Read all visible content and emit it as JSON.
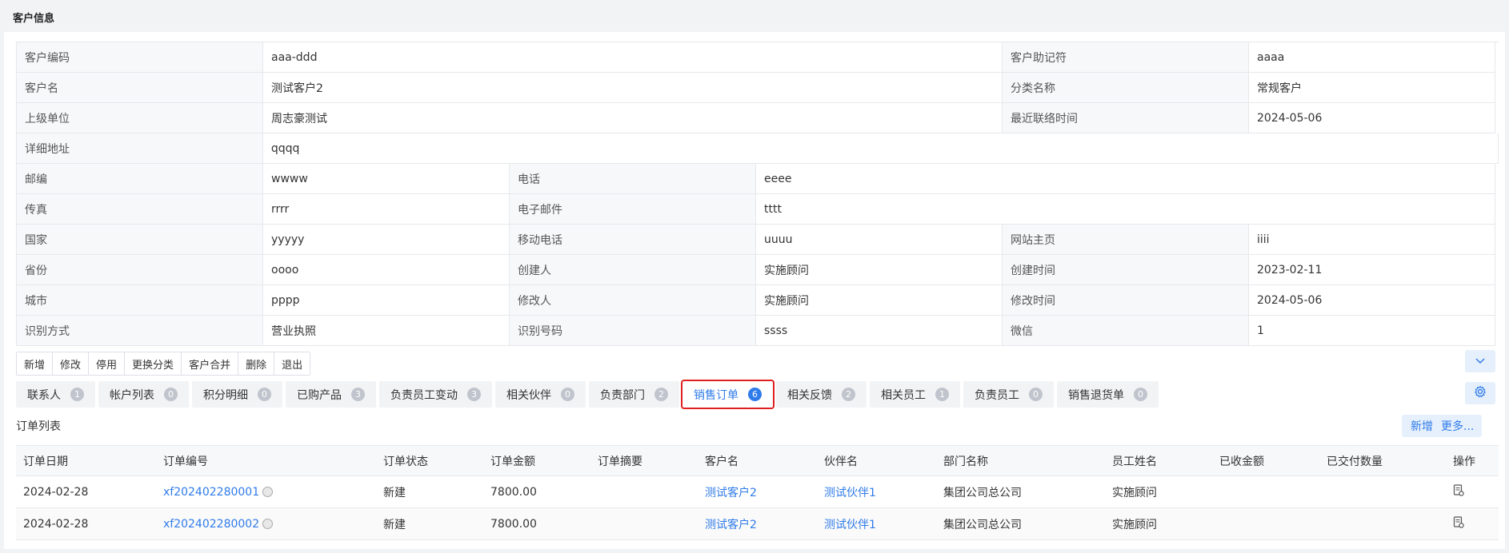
{
  "header": {
    "title": "客户信息"
  },
  "info": {
    "code_label": "客户编码",
    "code": "aaa-ddd",
    "mnemonic_label": "客户助记符",
    "mnemonic": "aaaa",
    "name_label": "客户名",
    "name": "测试客户2",
    "category_label": "分类名称",
    "category": "常规客户",
    "parent_label": "上级单位",
    "parent": "周志豪测试",
    "last_contact_label": "最近联络时间",
    "last_contact": "2024-05-06",
    "address_label": "详细地址",
    "address": "qqqq",
    "zip_label": "邮编",
    "zip": "wwww",
    "phone_label": "电话",
    "phone": "eeee",
    "fax_label": "传真",
    "fax": "rrrr",
    "email_label": "电子邮件",
    "email": "tttt",
    "country_label": "国家",
    "country": "yyyyy",
    "mobile_label": "移动电话",
    "mobile": "uuuu",
    "website_label": "网站主页",
    "website": "iiii",
    "province_label": "省份",
    "province": "oooo",
    "creator_label": "创建人",
    "creator": "实施顾问",
    "created_label": "创建时间",
    "created": "2023-02-11",
    "city_label": "城市",
    "city": "pppp",
    "modifier_label": "修改人",
    "modifier": "实施顾问",
    "modified_label": "修改时间",
    "modified": "2024-05-06",
    "id_method_label": "识别方式",
    "id_method": "营业执照",
    "id_number_label": "识别号码",
    "id_number": "ssss",
    "wechat_label": "微信",
    "wechat": "1"
  },
  "toolbar": {
    "new": "新增",
    "edit": "修改",
    "disable": "停用",
    "change_category": "更换分类",
    "merge": "客户合并",
    "delete": "删除",
    "exit": "退出"
  },
  "tabs": [
    {
      "label": "联系人",
      "count": "1"
    },
    {
      "label": "帐户列表",
      "count": "0"
    },
    {
      "label": "积分明细",
      "count": "0"
    },
    {
      "label": "已购产品",
      "count": "3"
    },
    {
      "label": "负责员工变动",
      "count": "3"
    },
    {
      "label": "相关伙伴",
      "count": "0"
    },
    {
      "label": "负责部门",
      "count": "2"
    },
    {
      "label": "销售订单",
      "count": "6"
    },
    {
      "label": "相关反馈",
      "count": "2"
    },
    {
      "label": "相关员工",
      "count": "1"
    },
    {
      "label": "负责员工",
      "count": "0"
    },
    {
      "label": "销售退货单",
      "count": "0"
    }
  ],
  "orders": {
    "title": "订单列表",
    "new_label": "新增",
    "more_label": "更多...",
    "columns": [
      "订单日期",
      "订单编号",
      "订单状态",
      "订单金额",
      "订单摘要",
      "客户名",
      "伙伴名",
      "部门名称",
      "员工姓名",
      "已收金额",
      "已交付数量",
      "操作"
    ],
    "rows": [
      {
        "date": "2024-02-28",
        "number": "xf202402280001",
        "status": "新建",
        "amount": "7800.00",
        "summary": "",
        "customer": "测试客户2",
        "partner": "测试伙伴1",
        "dept": "集团公司总公司",
        "employee": "实施顾问",
        "received": "",
        "delivered": ""
      },
      {
        "date": "2024-02-28",
        "number": "xf202402280002",
        "status": "新建",
        "amount": "7800.00",
        "summary": "",
        "customer": "测试客户2",
        "partner": "测试伙伴1",
        "dept": "集团公司总公司",
        "employee": "实施顾问",
        "received": "",
        "delivered": ""
      }
    ]
  },
  "icons": {
    "expand": "chevron-down-icon",
    "settings": "gear-icon",
    "operation": "document-settings-icon",
    "row_radio": "radio-icon"
  },
  "colors": {
    "accent": "#2f7be9",
    "highlight_border": "#e02020"
  }
}
